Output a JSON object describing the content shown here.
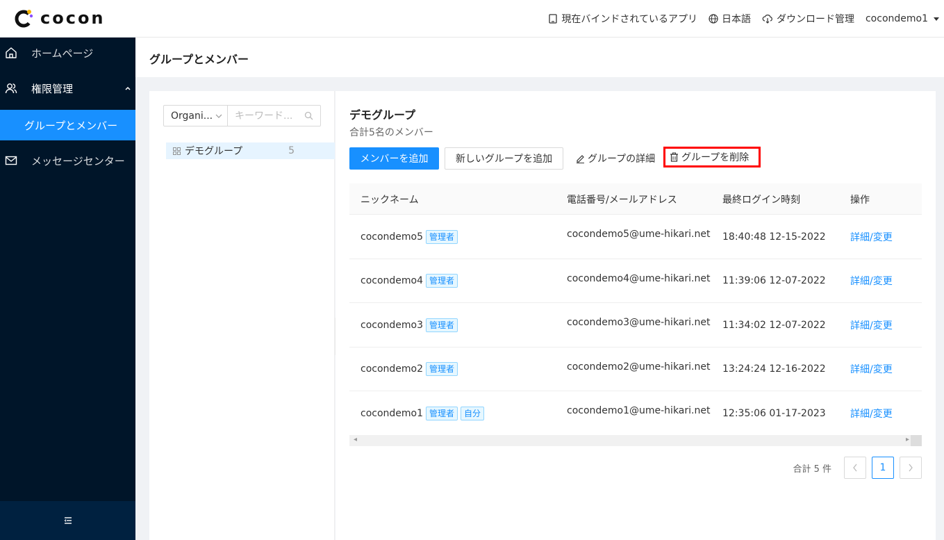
{
  "brand": {
    "logo_text": "cocon"
  },
  "topbar": {
    "bound_apps": "現在バインドされているアプリ",
    "language": "日本語",
    "downloads": "ダウンロード管理",
    "user": "cocondemo1"
  },
  "sidebar": {
    "home": "ホームページ",
    "permissions": "権限管理",
    "groups_members": "グループとメンバー",
    "message_center": "メッセージセンター"
  },
  "page": {
    "title": "グループとメンバー"
  },
  "left": {
    "org_select": "Organi...",
    "keyword_placeholder": "キーワード...",
    "tree": [
      {
        "label": "デモグループ",
        "count": "5"
      }
    ]
  },
  "group": {
    "name": "デモグループ",
    "summary": "合計5名のメンバー",
    "add_member": "メンバーを追加",
    "add_group": "新しいグループを追加",
    "group_detail": "グループの詳細",
    "delete_group": "グループを削除"
  },
  "table": {
    "headers": [
      "ニックネーム",
      "電話番号/メールアドレス",
      "最終ログイン時刻",
      "操作"
    ],
    "rows": [
      {
        "nickname": "cocondemo5",
        "tags": [
          "管理者"
        ],
        "email": "cocondemo5@ume-hikari.net",
        "last_login": "18:40:48 12-15-2022",
        "action": "詳細/変更"
      },
      {
        "nickname": "cocondemo4",
        "tags": [
          "管理者"
        ],
        "email": "cocondemo4@ume-hikari.net",
        "last_login": "11:39:06 12-07-2022",
        "action": "詳細/変更"
      },
      {
        "nickname": "cocondemo3",
        "tags": [
          "管理者"
        ],
        "email": "cocondemo3@ume-hikari.net",
        "last_login": "11:34:02 12-07-2022",
        "action": "詳細/変更"
      },
      {
        "nickname": "cocondemo2",
        "tags": [
          "管理者"
        ],
        "email": "cocondemo2@ume-hikari.net",
        "last_login": "13:24:24 12-16-2022",
        "action": "詳細/変更"
      },
      {
        "nickname": "cocondemo1",
        "tags": [
          "管理者",
          "自分"
        ],
        "email": "cocondemo1@ume-hikari.net",
        "last_login": "12:35:06 01-17-2023",
        "action": "詳細/変更"
      }
    ]
  },
  "pagination": {
    "total": "合計 5 件",
    "current": "1"
  },
  "colors": {
    "primary": "#1890ff",
    "sidebar_bg": "#001529",
    "highlight_border": "#ff0000"
  },
  "icons": [
    "logo-icon",
    "tablet-icon",
    "globe-icon",
    "cloud-download-icon",
    "caret-down-icon",
    "home-icon",
    "users-icon",
    "chevron-up-icon",
    "mail-icon",
    "menu-fold-icon",
    "chevron-down-icon",
    "search-icon",
    "apps-icon",
    "edit-icon",
    "trash-icon",
    "chevron-left-icon",
    "chevron-right-icon"
  ]
}
